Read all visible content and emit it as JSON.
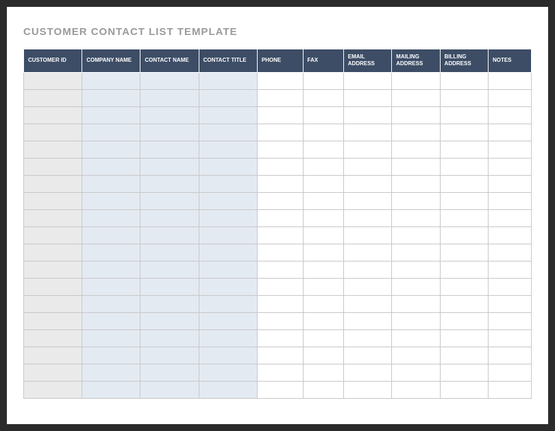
{
  "title": "CUSTOMER CONTACT LIST TEMPLATE",
  "columns": [
    {
      "label": "CUSTOMER ID",
      "style": "id"
    },
    {
      "label": "COMPANY NAME",
      "style": "blue"
    },
    {
      "label": "CONTACT NAME",
      "style": "blue"
    },
    {
      "label": "CONTACT TITLE",
      "style": "blue"
    },
    {
      "label": "PHONE",
      "style": "white"
    },
    {
      "label": "FAX",
      "style": "white"
    },
    {
      "label": "EMAIL ADDRESS",
      "style": "white"
    },
    {
      "label": "MAILING ADDRESS",
      "style": "white"
    },
    {
      "label": "BILLING ADDRESS",
      "style": "white"
    },
    {
      "label": "NOTES",
      "style": "white"
    }
  ],
  "rows": [
    [
      "",
      "",
      "",
      "",
      "",
      "",
      "",
      "",
      "",
      ""
    ],
    [
      "",
      "",
      "",
      "",
      "",
      "",
      "",
      "",
      "",
      ""
    ],
    [
      "",
      "",
      "",
      "",
      "",
      "",
      "",
      "",
      "",
      ""
    ],
    [
      "",
      "",
      "",
      "",
      "",
      "",
      "",
      "",
      "",
      ""
    ],
    [
      "",
      "",
      "",
      "",
      "",
      "",
      "",
      "",
      "",
      ""
    ],
    [
      "",
      "",
      "",
      "",
      "",
      "",
      "",
      "",
      "",
      ""
    ],
    [
      "",
      "",
      "",
      "",
      "",
      "",
      "",
      "",
      "",
      ""
    ],
    [
      "",
      "",
      "",
      "",
      "",
      "",
      "",
      "",
      "",
      ""
    ],
    [
      "",
      "",
      "",
      "",
      "",
      "",
      "",
      "",
      "",
      ""
    ],
    [
      "",
      "",
      "",
      "",
      "",
      "",
      "",
      "",
      "",
      ""
    ],
    [
      "",
      "",
      "",
      "",
      "",
      "",
      "",
      "",
      "",
      ""
    ],
    [
      "",
      "",
      "",
      "",
      "",
      "",
      "",
      "",
      "",
      ""
    ],
    [
      "",
      "",
      "",
      "",
      "",
      "",
      "",
      "",
      "",
      ""
    ],
    [
      "",
      "",
      "",
      "",
      "",
      "",
      "",
      "",
      "",
      ""
    ],
    [
      "",
      "",
      "",
      "",
      "",
      "",
      "",
      "",
      "",
      ""
    ],
    [
      "",
      "",
      "",
      "",
      "",
      "",
      "",
      "",
      "",
      ""
    ],
    [
      "",
      "",
      "",
      "",
      "",
      "",
      "",
      "",
      "",
      ""
    ],
    [
      "",
      "",
      "",
      "",
      "",
      "",
      "",
      "",
      "",
      ""
    ],
    [
      "",
      "",
      "",
      "",
      "",
      "",
      "",
      "",
      "",
      ""
    ]
  ]
}
